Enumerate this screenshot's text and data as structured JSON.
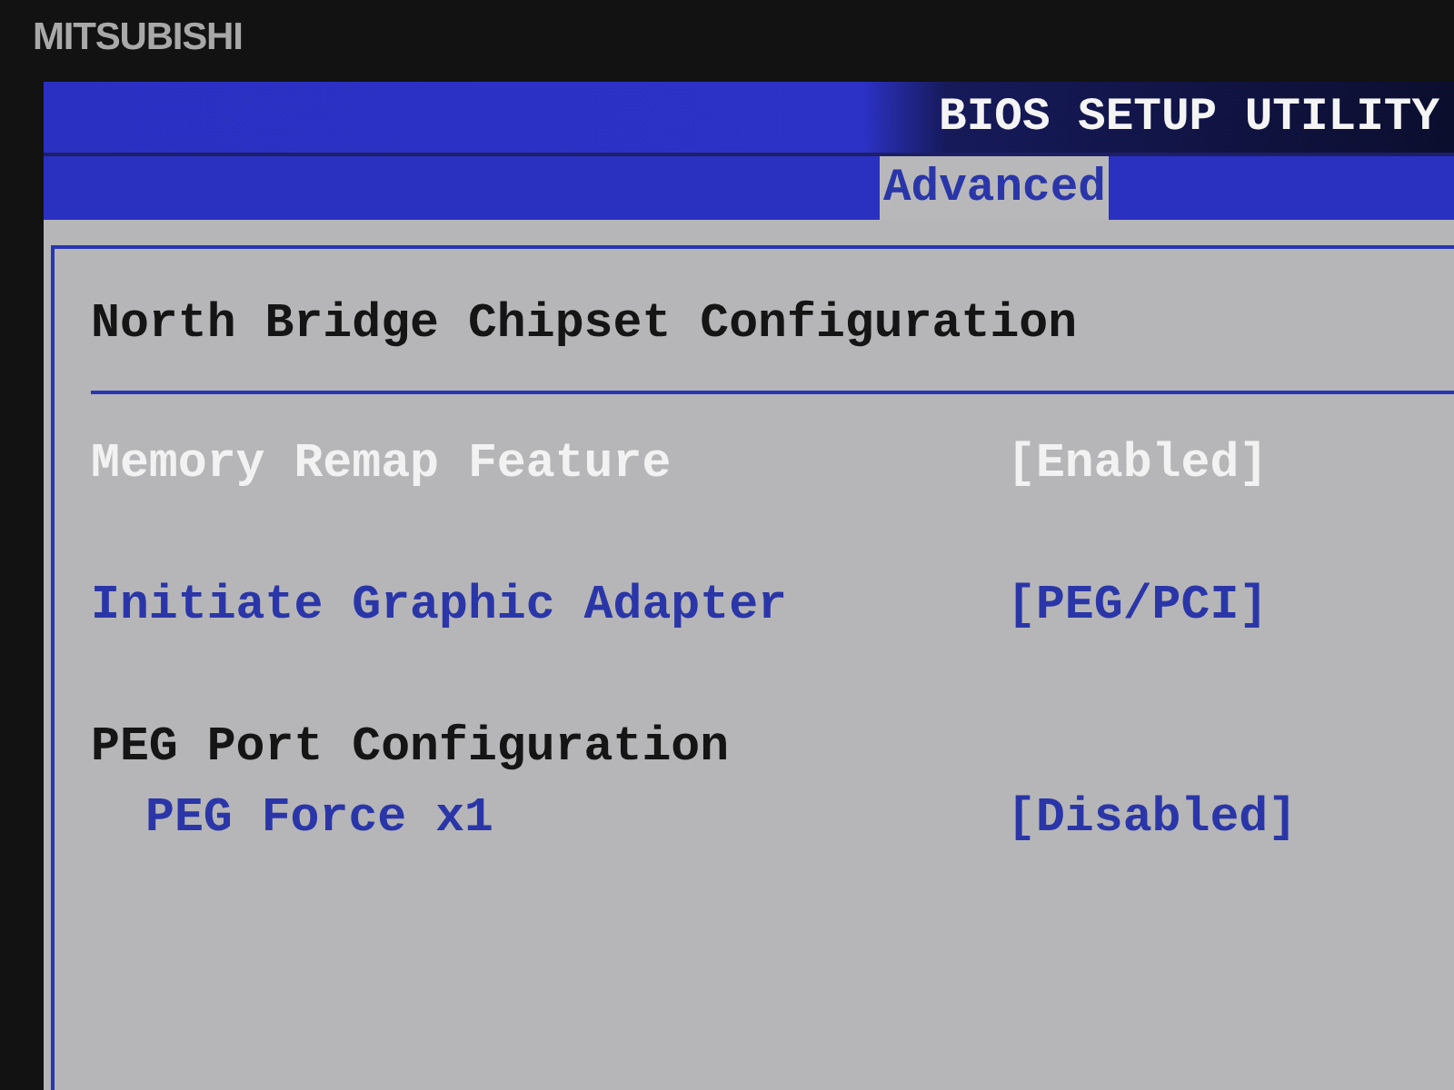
{
  "bezel": {
    "brand": "MITSUBISHI"
  },
  "header": {
    "title": "BIOS SETUP UTILITY"
  },
  "tabs": [
    {
      "label": "Advanced",
      "selected": true
    }
  ],
  "panel": {
    "title": "North Bridge Chipset Configuration",
    "items": [
      {
        "kind": "setting",
        "label": "Memory Remap Feature",
        "value": "[Enabled]",
        "selected": true
      },
      {
        "kind": "setting",
        "label": "Initiate Graphic Adapter",
        "value": "[PEG/PCI]",
        "selected": false
      },
      {
        "kind": "heading",
        "label": "PEG Port Configuration",
        "selected": false,
        "children": [
          {
            "kind": "setting",
            "label": "PEG Force x1",
            "value": "[Disabled]",
            "selected": false
          }
        ]
      }
    ]
  }
}
